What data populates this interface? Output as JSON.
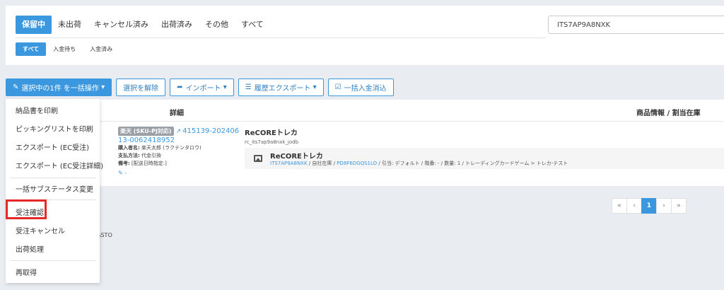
{
  "status_tabs": [
    "保留中",
    "未出荷",
    "キャンセル済み",
    "出荷済み",
    "その他",
    "すべて"
  ],
  "sub_tabs": [
    "すべて",
    "入金待ち",
    "入金済み"
  ],
  "search": {
    "value": "ITS7AP9A8NXK"
  },
  "actions": {
    "bulk": "選択中の1件 を一括操作",
    "clear": "選択を解除",
    "import": "インポート",
    "export_history": "履歴エクスポート",
    "bulk_payment": "一括入金消込"
  },
  "table": {
    "col_detail": "詳細",
    "col_product": "商品情報 / 割当在庫"
  },
  "order": {
    "mall": "楽天 (SKU-PJ対応)",
    "number_a": "415139-202406",
    "number_b": "13-0062418952",
    "buyer_label": "購入者名:",
    "buyer": "楽天太郎 (ラクテンタロウ)",
    "payment_label": "支払方法:",
    "payment": "代金引換",
    "note_label": "備考:",
    "note": "[配送日時指定:]",
    "edit": "-"
  },
  "product": {
    "name": "ReCOREトレカ",
    "code": "rc_its7ap9a8nxk_jodb",
    "inner_name": "ReCOREトレカ",
    "sku": "ITS7AP9A8NXK",
    "sep1": " / 自社在庫 / ",
    "stock_id": "PD8F6DGQS1LO",
    "rest": " / 引当: デフォルト / 階番: - / 数量: 1 / トレーディングカードゲーム > トレカ-テスト"
  },
  "pagination": [
    "«",
    "‹",
    "1",
    "›",
    "»"
  ],
  "stray_text": "ASTO",
  "dropdown": {
    "items": [
      "納品書を印刷",
      "ピッキングリストを印刷",
      "エクスポート (EC受注)",
      "エクスポート (EC受注詳細)",
      "一括サブステータス変更",
      "受注確認",
      "受注キャンセル",
      "出荷処理",
      "再取得"
    ]
  },
  "colors": {
    "accent": "#3b98df",
    "highlight": "#e52929"
  }
}
